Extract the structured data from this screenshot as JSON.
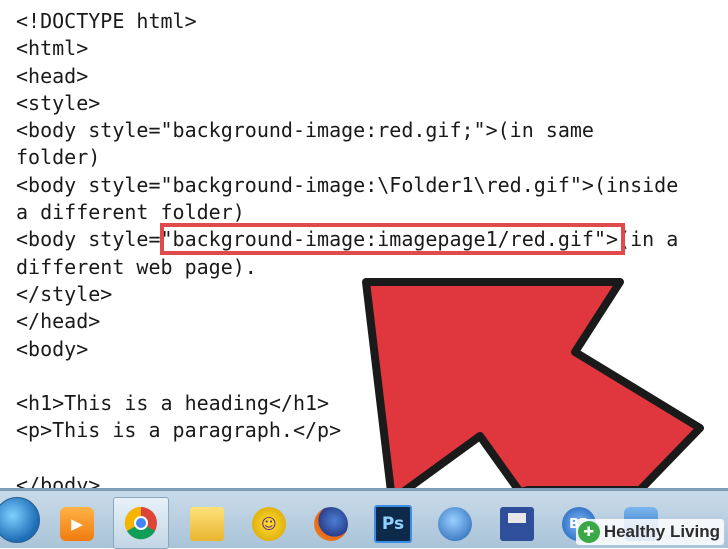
{
  "code_lines": [
    "<!DOCTYPE html>",
    "<html>",
    "<head>",
    "<style>",
    "<body style=\"background-image:red.gif;\">(in same",
    "folder)",
    "<body style=\"background-image:\\Folder1\\red.gif\">(inside",
    "a different folder)",
    "<body style=\"background-image:imagepage1/red.gif\">(in a",
    "different web page).",
    "</style>",
    "</head>",
    "<body>",
    "",
    "<h1>This is a heading</h1>",
    "<p>This is a paragraph.</p>",
    "",
    "</body>"
  ],
  "highlight": {
    "text": "\"background-image:imagepage1/red.gif\"",
    "color": "#e04a4a"
  },
  "arrow": {
    "color": "#e0363e",
    "outline": "#1a1a1a"
  },
  "taskbar": {
    "items": [
      {
        "name": "windows-start-icon"
      },
      {
        "name": "media-player-icon"
      },
      {
        "name": "chrome-icon",
        "active": true
      },
      {
        "name": "folder-icon"
      },
      {
        "name": "yahoo-messenger-icon"
      },
      {
        "name": "firefox-icon"
      },
      {
        "name": "photoshop-icon",
        "label": "Ps"
      },
      {
        "name": "thunderbird-icon"
      },
      {
        "name": "save-disk-icon"
      },
      {
        "name": "blackberry-icon",
        "label": "BB"
      },
      {
        "name": "app-icon"
      }
    ]
  },
  "watermark": {
    "text": "Healthy Living"
  }
}
